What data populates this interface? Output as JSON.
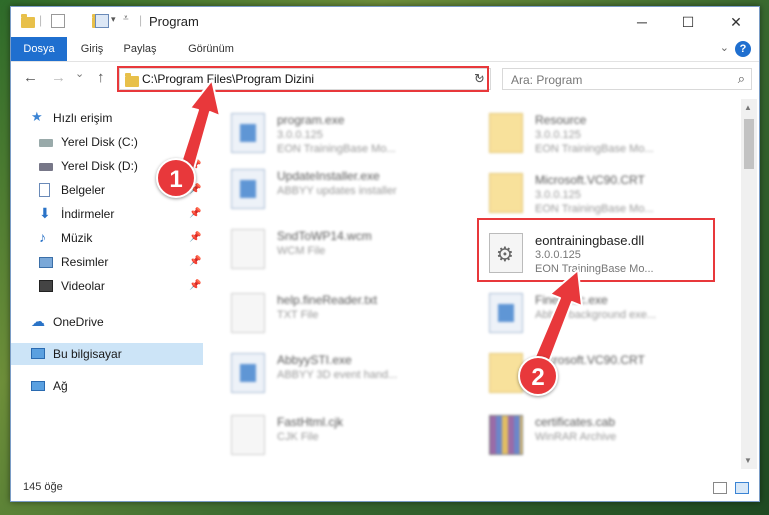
{
  "window": {
    "title": "Program",
    "minimize": "─",
    "maximize": "☐",
    "close": "✕"
  },
  "ribbon": {
    "tabs": [
      {
        "label": "Dosya",
        "active": true
      },
      {
        "label": "Giriş",
        "active": false
      },
      {
        "label": "Paylaş",
        "active": false
      },
      {
        "label": "Görünüm",
        "active": false
      }
    ],
    "help": "?"
  },
  "nav": {
    "back": "←",
    "forward": "→",
    "recent": "⌄",
    "up": "↑",
    "address": "C:\\Program Files\\Program Dizini",
    "refresh": "↻"
  },
  "search": {
    "placeholder": "Ara: Program",
    "icon": "search-icon"
  },
  "sidebar": {
    "items": [
      {
        "label": "Hızlı erişim",
        "icon": "star-icon",
        "pinned": false
      },
      {
        "label": "Yerel Disk (C:)",
        "icon": "drive-icon",
        "pinned": true
      },
      {
        "label": "Yerel Disk (D:)",
        "icon": "drive-icon",
        "pinned": true
      },
      {
        "label": "Belgeler",
        "icon": "documents-icon",
        "pinned": true
      },
      {
        "label": "İndirmeler",
        "icon": "download-icon",
        "pinned": true
      },
      {
        "label": "Müzik",
        "icon": "music-icon",
        "pinned": true
      },
      {
        "label": "Resimler",
        "icon": "pictures-icon",
        "pinned": true
      },
      {
        "label": "Videolar",
        "icon": "video-icon",
        "pinned": true
      },
      {
        "label": "OneDrive",
        "icon": "cloud-icon",
        "pinned": false
      },
      {
        "label": "Bu bilgisayar",
        "icon": "computer-icon",
        "pinned": false
      },
      {
        "label": "Ağ",
        "icon": "network-icon",
        "pinned": false
      }
    ]
  },
  "files": {
    "left": [
      {
        "name": "program.exe",
        "version": "3.0.0.125",
        "desc": "EON TrainingBase Mo..."
      },
      {
        "name": "UpdateInstaller.exe",
        "version": "",
        "desc": "ABBYY updates installer"
      },
      {
        "name": "SndToWP14.wcm",
        "version": "",
        "desc": "WCM File"
      },
      {
        "name": "help.fineReader.txt",
        "version": "",
        "desc": "TXT File"
      },
      {
        "name": "AbbyySTI.exe",
        "version": "",
        "desc": "ABBYY 3D event hand..."
      },
      {
        "name": "FastHtml.cjk",
        "version": "",
        "desc": "CJK File"
      }
    ],
    "right": [
      {
        "name": "Resource",
        "version": "3.0.0.125",
        "desc": "EON TrainingBase Mo..."
      },
      {
        "name": "Microsoft.VC90.CRT",
        "version": "3.0.0.125",
        "desc": "EON TrainingBase Mo..."
      },
      {
        "name": "eontrainingbase.dll",
        "version": "3.0.0.125",
        "desc": "EON TrainingBase Mo..."
      },
      {
        "name": "FineExec.exe",
        "version": "",
        "desc": "Abbyy background exe..."
      },
      {
        "name": "Microsoft.VC90.CRT",
        "version": "",
        "desc": ""
      },
      {
        "name": "certificates.cab",
        "version": "",
        "desc": "WinRAR Archive"
      }
    ]
  },
  "status": {
    "count": "145 öğe"
  },
  "annotations": {
    "badge1": "1",
    "badge2": "2",
    "color": "#e8383b"
  }
}
